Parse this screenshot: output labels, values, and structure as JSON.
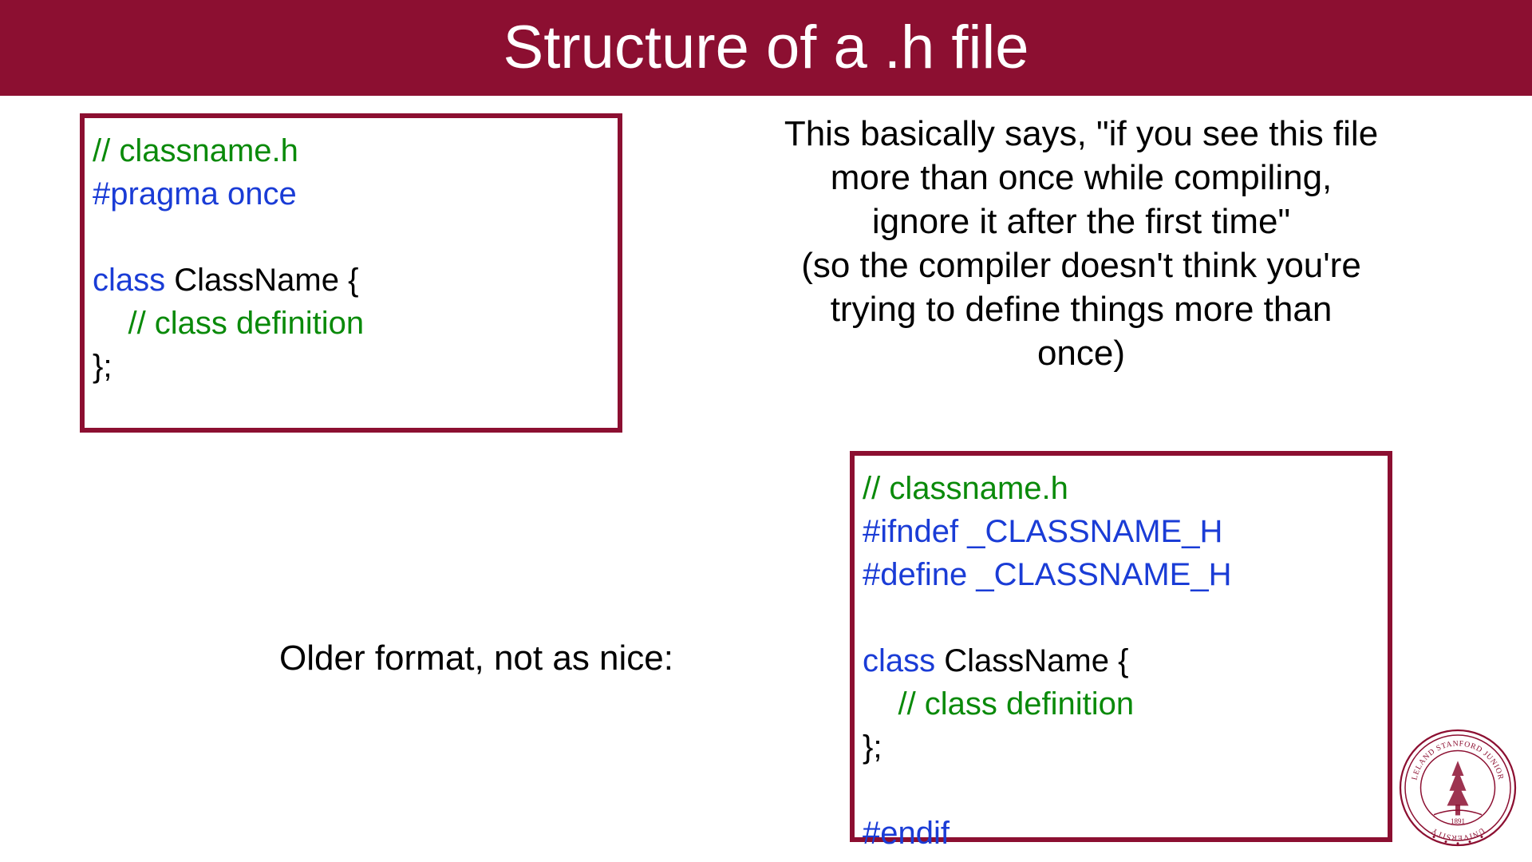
{
  "title": "Structure of a .h file",
  "code1": {
    "l1": "// classname.h",
    "l2": "#pragma once",
    "l3a": "class",
    "l3b": " ClassName {",
    "l4": "    // class definition",
    "l5": "};"
  },
  "explain": {
    "l1": "This basically says, \"if you see this file",
    "l2": "more than once while compiling,",
    "l3": "ignore it after the first time\"",
    "l4": "(so the compiler doesn't think you're",
    "l5": "trying to define things more than",
    "l6": "once)"
  },
  "older_label": "Older format, not as nice:",
  "code2": {
    "l1": "// classname.h",
    "l2": "#ifndef _CLASSNAME_H",
    "l3": "#define _CLASSNAME_H",
    "l4a": "class",
    "l4b": " ClassName {",
    "l5": "    // class definition",
    "l6": "};",
    "l7": "#endif"
  },
  "seal": {
    "top_text": "LELAND STANFORD JUNIOR",
    "bottom_text": "UNIVERSITY",
    "year": "1891"
  }
}
